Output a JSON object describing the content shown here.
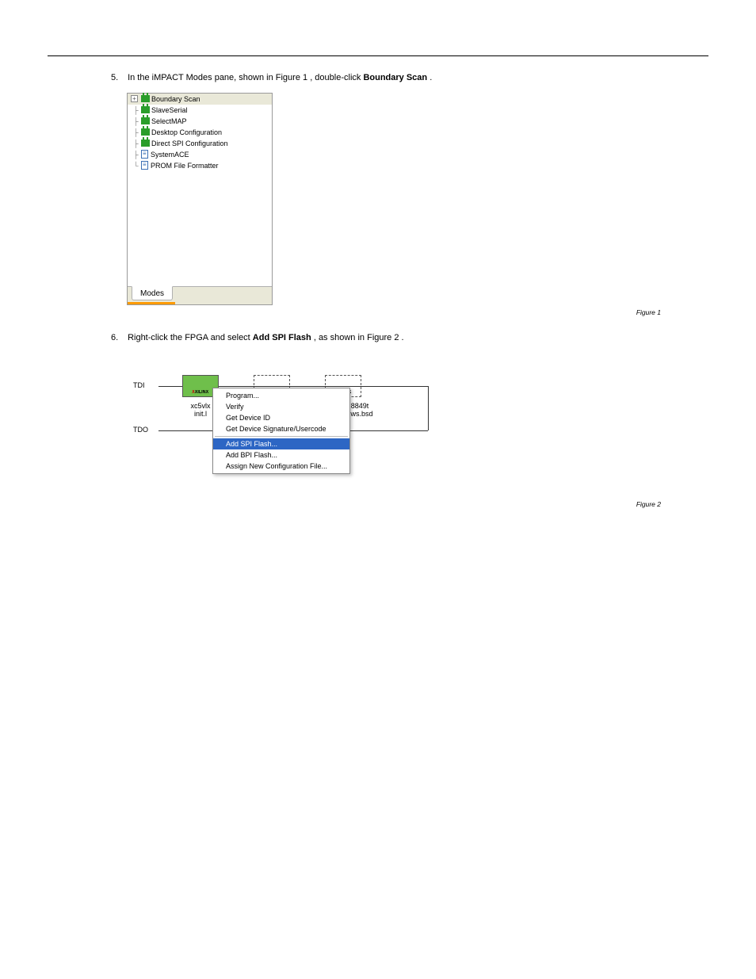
{
  "instructions": {
    "step5": {
      "num": "5.",
      "text_a": "In the iMPACT Modes pane, shown in ",
      "fig_ref": "Figure 1",
      "text_b": ", double-click ",
      "bold": "Boundary Scan",
      "text_c": "."
    },
    "step6": {
      "num": "6.",
      "text_a": "Right-click the FPGA and select ",
      "bold": "Add SPI Flash",
      "text_b": ", as shown in ",
      "fig_ref": "Figure 2",
      "text_c": "."
    }
  },
  "tree": {
    "root": "Boundary Scan",
    "items": [
      "SlaveSerial",
      "SelectMAP",
      "Desktop Configuration",
      "Direct SPI Configuration",
      "SystemACE",
      "PROM File Formatter"
    ],
    "tab": "Modes"
  },
  "chain": {
    "tdi": "TDI",
    "tdo": "TDO",
    "chip_logo": "XILINX",
    "device1_line1": "xc5vlx",
    "device1_line2": "init.l",
    "device3_line1": "8849t",
    "device3_line2": "9ws.bsd",
    "menu": [
      "Program...",
      "Verify",
      "Get Device ID",
      "Get Device Signature/Usercode",
      "Add SPI Flash...",
      "Add BPI Flash...",
      "Assign New Configuration File..."
    ]
  },
  "captions": {
    "fig1": "Figure 1",
    "fig2": "Figure 2"
  }
}
